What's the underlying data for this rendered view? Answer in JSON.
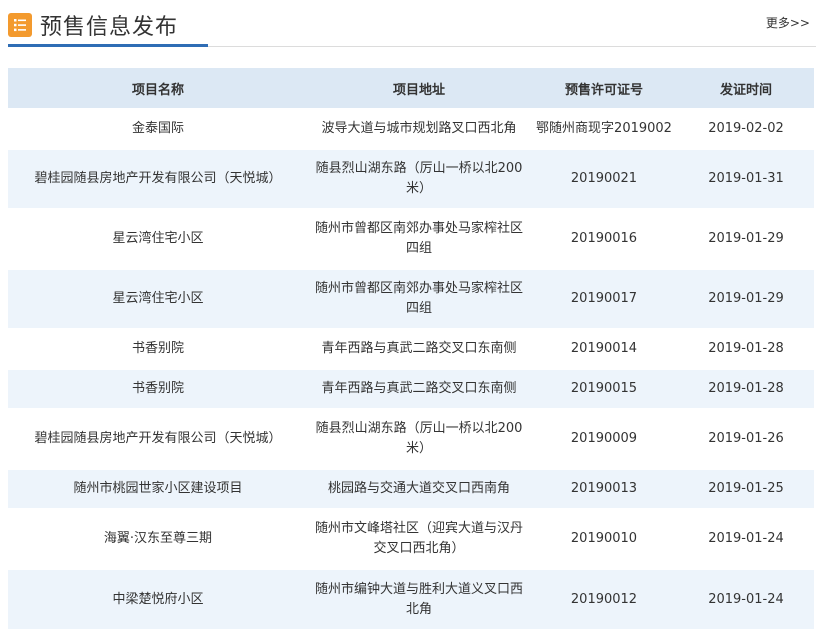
{
  "header": {
    "title": "预售信息发布",
    "more_label": "更多>>",
    "icon": "list-icon"
  },
  "table": {
    "columns": [
      "项目名称",
      "项目地址",
      "预售许可证号",
      "发证时间"
    ],
    "rows": [
      {
        "name": "金泰国际",
        "address": "波导大道与城市规划路叉口西北角",
        "license": "鄂随州商现字2019002",
        "date": "2019-02-02"
      },
      {
        "name": "碧桂园随县房地产开发有限公司（天悦城）",
        "address": "随县烈山湖东路（厉山一桥以北200米）",
        "license": "20190021",
        "date": "2019-01-31"
      },
      {
        "name": "星云湾住宅小区",
        "address": "随州市曾都区南郊办事处马家榨社区四组",
        "license": "20190016",
        "date": "2019-01-29"
      },
      {
        "name": "星云湾住宅小区",
        "address": "随州市曾都区南郊办事处马家榨社区四组",
        "license": "20190017",
        "date": "2019-01-29"
      },
      {
        "name": "书香别院",
        "address": "青年西路与真武二路交叉口东南侧",
        "license": "20190014",
        "date": "2019-01-28"
      },
      {
        "name": "书香别院",
        "address": "青年西路与真武二路交叉口东南侧",
        "license": "20190015",
        "date": "2019-01-28"
      },
      {
        "name": "碧桂园随县房地产开发有限公司（天悦城）",
        "address": "随县烈山湖东路（厉山一桥以北200米）",
        "license": "20190009",
        "date": "2019-01-26"
      },
      {
        "name": "随州市桃园世家小区建设项目",
        "address": "桃园路与交通大道交叉口西南角",
        "license": "20190013",
        "date": "2019-01-25"
      },
      {
        "name": "海翼·汉东至尊三期",
        "address": "随州市文峰塔社区（迎宾大道与汉丹交叉口西北角）",
        "license": "20190010",
        "date": "2019-01-24"
      },
      {
        "name": "中梁楚悦府小区",
        "address": "随州市编钟大道与胜利大道义叉口西北角",
        "license": "20190012",
        "date": "2019-01-24"
      }
    ]
  }
}
